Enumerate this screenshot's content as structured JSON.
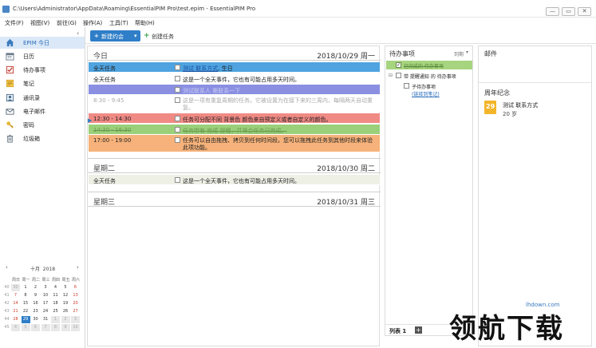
{
  "window": {
    "title": "C:\\Users\\Administrator\\AppData\\Roaming\\EssentialPIM Pro\\test.epim - EssentialPIM Pro",
    "buttons": [
      "—",
      "▭",
      "✕"
    ]
  },
  "menu": [
    "文件(F)",
    "视图(V)",
    "前往(G)",
    "操作(A)",
    "工具(T)",
    "帮助(H)"
  ],
  "sidebar": {
    "items": [
      {
        "label": "EPIM 今日",
        "icon": "home-icon",
        "active": true
      },
      {
        "label": "日历",
        "icon": "calendar-icon",
        "active": false
      },
      {
        "label": "待办事项",
        "icon": "todo-icon",
        "active": false
      },
      {
        "label": "笔记",
        "icon": "notes-icon",
        "active": false
      },
      {
        "label": "通讯录",
        "icon": "contacts-icon",
        "active": false
      },
      {
        "label": "电子邮件",
        "icon": "email-icon",
        "active": false
      },
      {
        "label": "密码",
        "icon": "key-icon",
        "active": false
      },
      {
        "label": "垃圾箱",
        "icon": "trash-icon",
        "active": false
      }
    ],
    "collapse": "‹"
  },
  "minical": {
    "month": "十月",
    "year": "2018",
    "weekdays": [
      "周日",
      "周一",
      "周二",
      "周三",
      "周四",
      "周五",
      "周六"
    ],
    "weeks": [
      {
        "wk": "40",
        "days": [
          "30",
          "1",
          "2",
          "3",
          "4",
          "5",
          "6"
        ]
      },
      {
        "wk": "41",
        "days": [
          "7",
          "8",
          "9",
          "10",
          "11",
          "12",
          "13"
        ]
      },
      {
        "wk": "42",
        "days": [
          "14",
          "15",
          "16",
          "17",
          "18",
          "19",
          "20"
        ]
      },
      {
        "wk": "43",
        "days": [
          "21",
          "22",
          "23",
          "24",
          "25",
          "26",
          "27"
        ]
      },
      {
        "wk": "44",
        "days": [
          "28",
          "29",
          "30",
          "31",
          "1",
          "2",
          "3"
        ]
      },
      {
        "wk": "45",
        "days": [
          "4",
          "5",
          "6",
          "7",
          "8",
          "9",
          "10"
        ]
      }
    ],
    "selected_day": "29",
    "colors": {
      "weekend": "#d13a2a",
      "selected": "#2f7ec7"
    }
  },
  "toolbar": {
    "new_event": "新建约会",
    "new_task": "创建任务"
  },
  "days": [
    {
      "name": "今日",
      "date": "2018/10/29 周一",
      "rows": [
        {
          "time": "全天任务",
          "text_link": "测试 联系方式",
          "text": ", 生日",
          "bg": "#4fa3e0",
          "color": "#1a1a1a",
          "checkbox": true
        },
        {
          "time": "全天任务",
          "text": "这是一个全天事件，它也有可能占用多天时间。",
          "bg": "#ffffff",
          "color": "#222",
          "checkbox": true
        },
        {
          "time": "",
          "text": "测试联系人  需联系一下",
          "bg": "#8a8fe2",
          "color": "#c9ccf3",
          "checkbox": true
        },
        {
          "time": "8:30 - 9:45",
          "text": "这是一项有重复周期的任务。它被设置为在接下来的三周内，每隔两天自动重复。",
          "bg": "#ffffff",
          "color": "#a9a9a9",
          "checkbox": true
        },
        {
          "time": "12:30 - 14:30",
          "text": "任务可分配不同 背景色  颜色来自预定义或者自定义的颜色。",
          "bg": "#f08a84",
          "color": "#222",
          "checkbox": true
        },
        {
          "time": "14:30 - 16:30",
          "text": "任务带有 完成 提醒，并将会任务已完成。",
          "bg": "#9bd07a",
          "color": "#6a9a50",
          "checkbox": true
        },
        {
          "time": "17:00 - 19:00",
          "text": "任务可以自由拖拽、拷贝到任何时间段。您可以拖拽此任务到其他时段来体验此项功能。",
          "bg": "#f6b27a",
          "color": "#222",
          "checkbox": true
        }
      ]
    },
    {
      "name": "星期二",
      "date": "2018/10/30 周二",
      "rows": [
        {
          "time": "全天任务",
          "text": "这是一个全天事件，它也有可能占用多天时间。",
          "bg": "#eef0e6",
          "color": "#222",
          "checkbox": true
        }
      ]
    },
    {
      "name": "星期三",
      "date": "2018/10/31 周三",
      "rows": []
    }
  ],
  "todo": {
    "title": "待办事项",
    "filter": "到期",
    "items": [
      {
        "text": "已完成的 待办事项",
        "done": true
      },
      {
        "text": "带 提醒通知 的 待办事项",
        "done": false
      },
      {
        "text": "子待办事项",
        "done": false
      },
      {
        "text": "(链接到笔记)",
        "done": false
      }
    ],
    "footer_tab": "列表 1",
    "footer_add": "+"
  },
  "mail": {
    "title": "邮件"
  },
  "anniversary": {
    "title": "周年纪念",
    "day": "29",
    "name": "测试 联系方式",
    "age": "20 岁"
  },
  "watermark": {
    "text": "领航下载",
    "url": "lhdown.com"
  }
}
